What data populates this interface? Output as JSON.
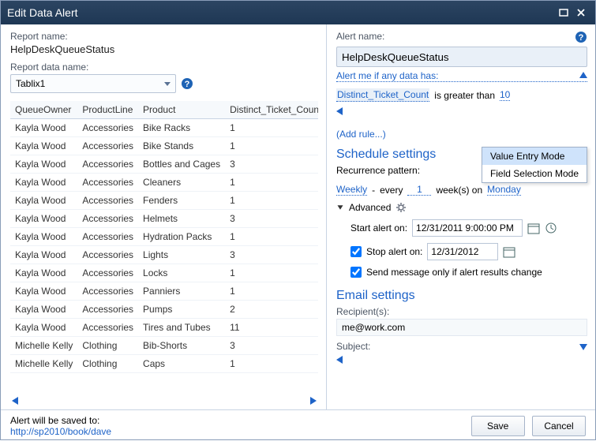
{
  "window": {
    "title": "Edit Data Alert"
  },
  "left": {
    "report_name_label": "Report name:",
    "report_name": "HelpDeskQueueStatus",
    "report_data_label": "Report data name:",
    "report_data_selected": "Tablix1",
    "columns": [
      "QueueOwner",
      "ProductLine",
      "Product",
      "Distinct_Ticket_Count"
    ],
    "rows": [
      [
        "Kayla Wood",
        "Accessories",
        "Bike Racks",
        "1"
      ],
      [
        "Kayla Wood",
        "Accessories",
        "Bike Stands",
        "1"
      ],
      [
        "Kayla Wood",
        "Accessories",
        "Bottles and Cages",
        "3"
      ],
      [
        "Kayla Wood",
        "Accessories",
        "Cleaners",
        "1"
      ],
      [
        "Kayla Wood",
        "Accessories",
        "Fenders",
        "1"
      ],
      [
        "Kayla Wood",
        "Accessories",
        "Helmets",
        "3"
      ],
      [
        "Kayla Wood",
        "Accessories",
        "Hydration Packs",
        "1"
      ],
      [
        "Kayla Wood",
        "Accessories",
        "Lights",
        "3"
      ],
      [
        "Kayla Wood",
        "Accessories",
        "Locks",
        "1"
      ],
      [
        "Kayla Wood",
        "Accessories",
        "Panniers",
        "1"
      ],
      [
        "Kayla Wood",
        "Accessories",
        "Pumps",
        "2"
      ],
      [
        "Kayla Wood",
        "Accessories",
        "Tires and Tubes",
        "11"
      ],
      [
        "Michelle Kelly",
        "Clothing",
        "Bib-Shorts",
        "3"
      ],
      [
        "Michelle Kelly",
        "Clothing",
        "Caps",
        "1"
      ]
    ],
    "save_info_label": "Alert will be saved to:",
    "save_path": "http://sp2010/book/dave"
  },
  "right": {
    "alert_name_label": "Alert name:",
    "alert_name_value": "HelpDeskQueueStatus",
    "alert_me_label": "Alert me if any data has:",
    "rule": {
      "field": "Distinct_Ticket_Count",
      "operator": "is greater than",
      "value": "10"
    },
    "mode_menu": {
      "value_entry": "Value Entry Mode",
      "field_selection": "Field Selection Mode"
    },
    "add_rule": "(Add rule...)",
    "schedule_heading": "Schedule settings",
    "recurrence_label": "Recurrence pattern:",
    "recurrence": {
      "unit_link": "Weekly",
      "dash": "-",
      "every": "every",
      "interval": "1",
      "weeks_on": "week(s) on",
      "day_link": "Monday"
    },
    "advanced_label": "Advanced",
    "start_label": "Start alert on:",
    "start_value": "12/31/2011 9:00:00 PM",
    "stop_label": "Stop alert on:",
    "stop_value": "12/31/2012",
    "stop_checked": true,
    "only_change_label": "Send message only if alert results change",
    "only_change_checked": true,
    "email_heading": "Email settings",
    "recipients_label": "Recipient(s):",
    "recipients_value": "me@work.com",
    "subject_label": "Subject:"
  },
  "buttons": {
    "save": "Save",
    "cancel": "Cancel"
  }
}
